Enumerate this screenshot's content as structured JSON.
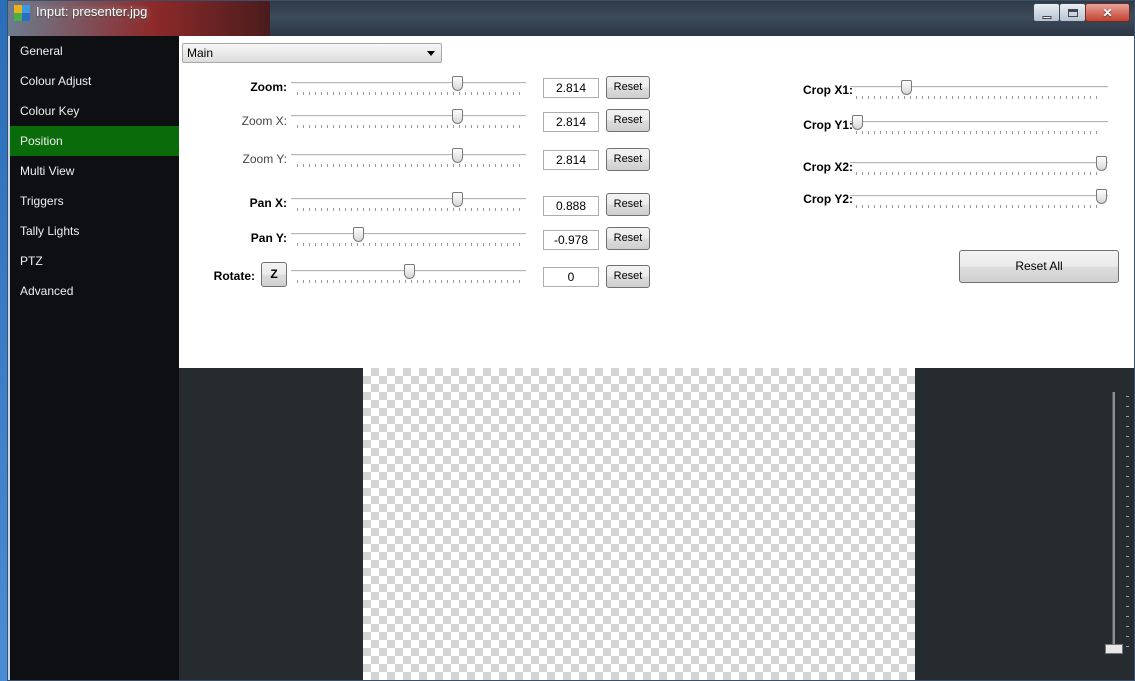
{
  "window": {
    "title": "Input: presenter.jpg"
  },
  "sidebar": {
    "items": [
      {
        "label": "General",
        "active": false
      },
      {
        "label": "Colour Adjust",
        "active": false
      },
      {
        "label": "Colour Key",
        "active": false
      },
      {
        "label": "Position",
        "active": true
      },
      {
        "label": "Multi View",
        "active": false
      },
      {
        "label": "Triggers",
        "active": false
      },
      {
        "label": "Tally Lights",
        "active": false
      },
      {
        "label": "PTZ",
        "active": false
      },
      {
        "label": "Advanced",
        "active": false
      }
    ]
  },
  "position": {
    "layer_select": {
      "value": "Main"
    },
    "zoom": {
      "label": "Zoom:",
      "value": "2.814",
      "reset": "Reset",
      "level": 0.72
    },
    "zoom_x": {
      "label": "Zoom X:",
      "value": "2.814",
      "reset": "Reset",
      "level": 0.72
    },
    "zoom_y": {
      "label": "Zoom Y:",
      "value": "2.814",
      "reset": "Reset",
      "level": 0.72
    },
    "pan_x": {
      "label": "Pan X:",
      "value": "0.888",
      "reset": "Reset",
      "level": 0.72
    },
    "pan_y": {
      "label": "Pan Y:",
      "value": "-0.978",
      "reset": "Reset",
      "level": 0.27
    },
    "rotate": {
      "label": "Rotate:",
      "z_button": "Z",
      "value": "0",
      "reset": "Reset",
      "level": 0.5
    },
    "crop_x1": {
      "label": "Crop X1:",
      "level": 0.2
    },
    "crop_y1": {
      "label": "Crop Y1:",
      "level": 0.0
    },
    "crop_x2": {
      "label": "Crop X2:",
      "level": 1.0
    },
    "crop_y2": {
      "label": "Crop Y2:",
      "level": 1.0
    },
    "reset_all": "Reset All"
  },
  "preview": {
    "volume_level": 0.0
  },
  "colors": {
    "active_tab": "#0a6b0a",
    "sidebar_bg": "#0d0f12",
    "preview_bg": "#262b2f"
  }
}
